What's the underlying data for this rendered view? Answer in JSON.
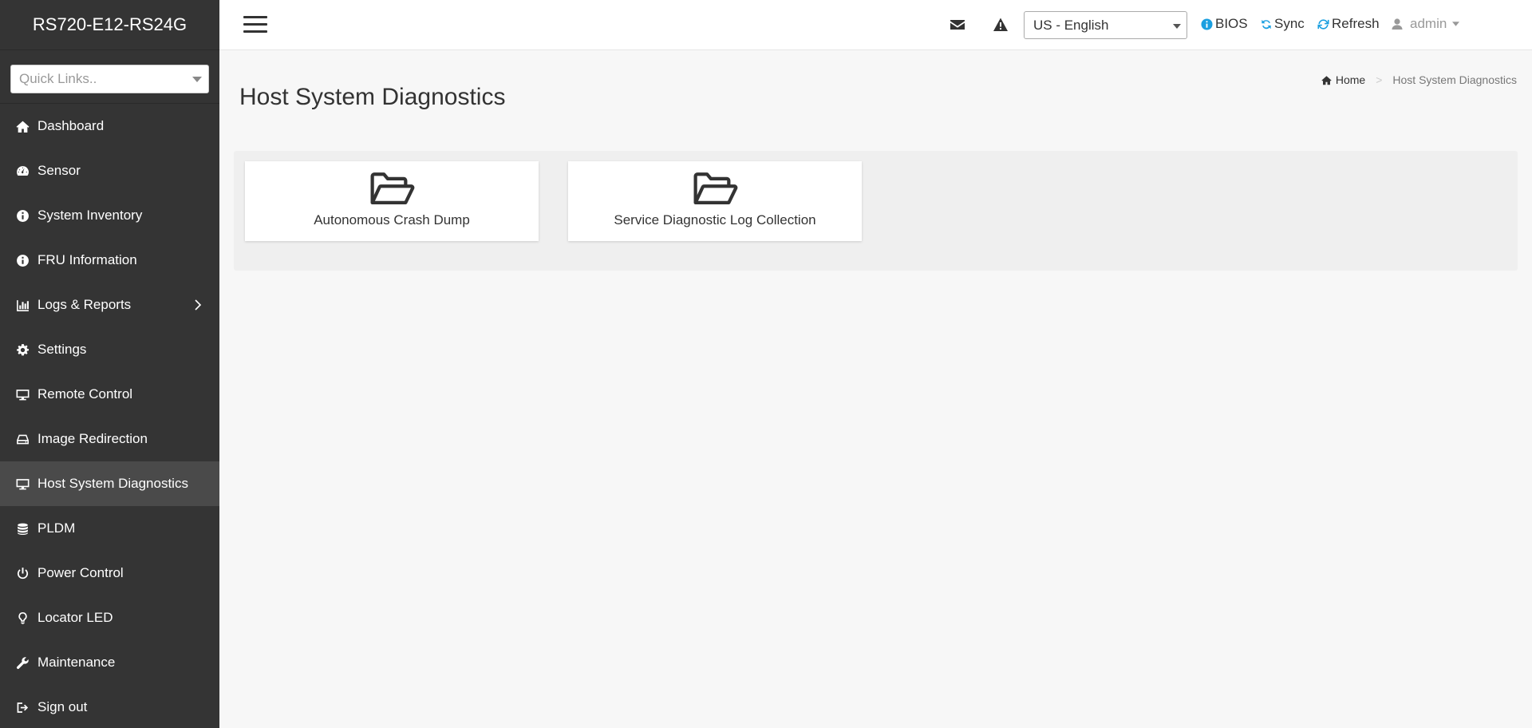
{
  "brand": "RS720-E12-RS24G",
  "quick_links": {
    "placeholder": "Quick Links.."
  },
  "sidebar": {
    "items": [
      {
        "label": "Dashboard",
        "icon": "home-icon"
      },
      {
        "label": "Sensor",
        "icon": "gauge-icon"
      },
      {
        "label": "System Inventory",
        "icon": "info-icon"
      },
      {
        "label": "FRU Information",
        "icon": "info-icon"
      },
      {
        "label": "Logs & Reports",
        "icon": "bar-chart-icon",
        "has_submenu": true
      },
      {
        "label": "Settings",
        "icon": "gear-icon"
      },
      {
        "label": "Remote Control",
        "icon": "monitor-icon"
      },
      {
        "label": "Image Redirection",
        "icon": "hdd-icon"
      },
      {
        "label": "Host System Diagnostics",
        "icon": "monitor-icon",
        "active": true
      },
      {
        "label": "PLDM",
        "icon": "database-icon"
      },
      {
        "label": "Power Control",
        "icon": "power-icon"
      },
      {
        "label": "Locator LED",
        "icon": "lightbulb-icon"
      },
      {
        "label": "Maintenance",
        "icon": "wrench-icon"
      },
      {
        "label": "Sign out",
        "icon": "sign-out-icon"
      }
    ]
  },
  "header": {
    "language": "US - English",
    "bios": "BIOS",
    "sync": "Sync",
    "refresh": "Refresh",
    "user": "admin",
    "accent": "#1a9fe0"
  },
  "breadcrumb": {
    "home": "Home",
    "current": "Host System Diagnostics"
  },
  "page": {
    "title": "Host System Diagnostics"
  },
  "cards": [
    {
      "label": "Autonomous Crash Dump",
      "icon": "folder-open-icon"
    },
    {
      "label": "Service Diagnostic Log Collection",
      "icon": "folder-open-icon"
    }
  ]
}
